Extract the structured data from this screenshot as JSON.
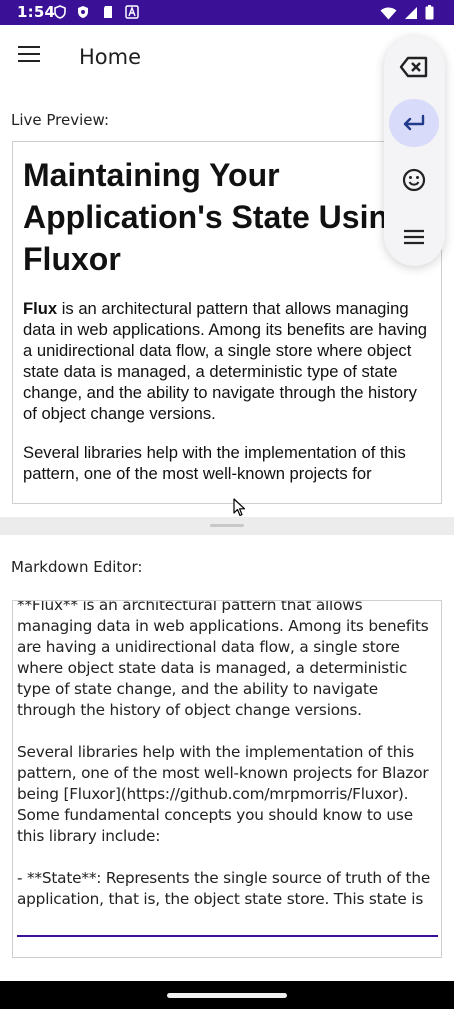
{
  "status_bar": {
    "time": "1:54",
    "background": "#3a1096"
  },
  "app_bar": {
    "title": "Home",
    "menu_icon": "hamburger-menu-icon"
  },
  "preview": {
    "label": "Live Preview:",
    "heading": "Maintaining Your Application's State Using Fluxor",
    "para1_bold": "Flux",
    "para1_rest": " is an architectural pattern that allows managing data in web applications. Among its benefits are having a unidirectional data flow, a single store where object state data is managed, a deterministic type of state change, and the ability to navigate through the history of object change versions.",
    "para2": "Several libraries help with the implementation of this pattern, one of the most well-known projects for"
  },
  "editor": {
    "label": "Markdown Editor:",
    "content": "**Flux** is an architectural pattern that allows managing data in web applications. Among its benefits are having a unidirectional data flow, a single store where object state data is managed, a deterministic type of state change, and the ability to navigate through the history of object change versions.\n\nSeveral libraries help with the implementation of this pattern, one of the most well-known projects for Blazor being [Fluxor](https://github.com/mrpmorris/Fluxor). Some fundamental concepts you should know to use this library include:\n\n- **State**: Represents the single source of truth of the application, that is, the object state store. This state is",
    "accent": "#3a1096"
  },
  "toolbar": {
    "buttons": [
      {
        "icon": "backspace-icon"
      },
      {
        "icon": "enter-return-icon",
        "active": true
      },
      {
        "icon": "emoji-icon"
      },
      {
        "icon": "menu-lines-icon"
      }
    ],
    "active_color": "#d8dcfa"
  }
}
